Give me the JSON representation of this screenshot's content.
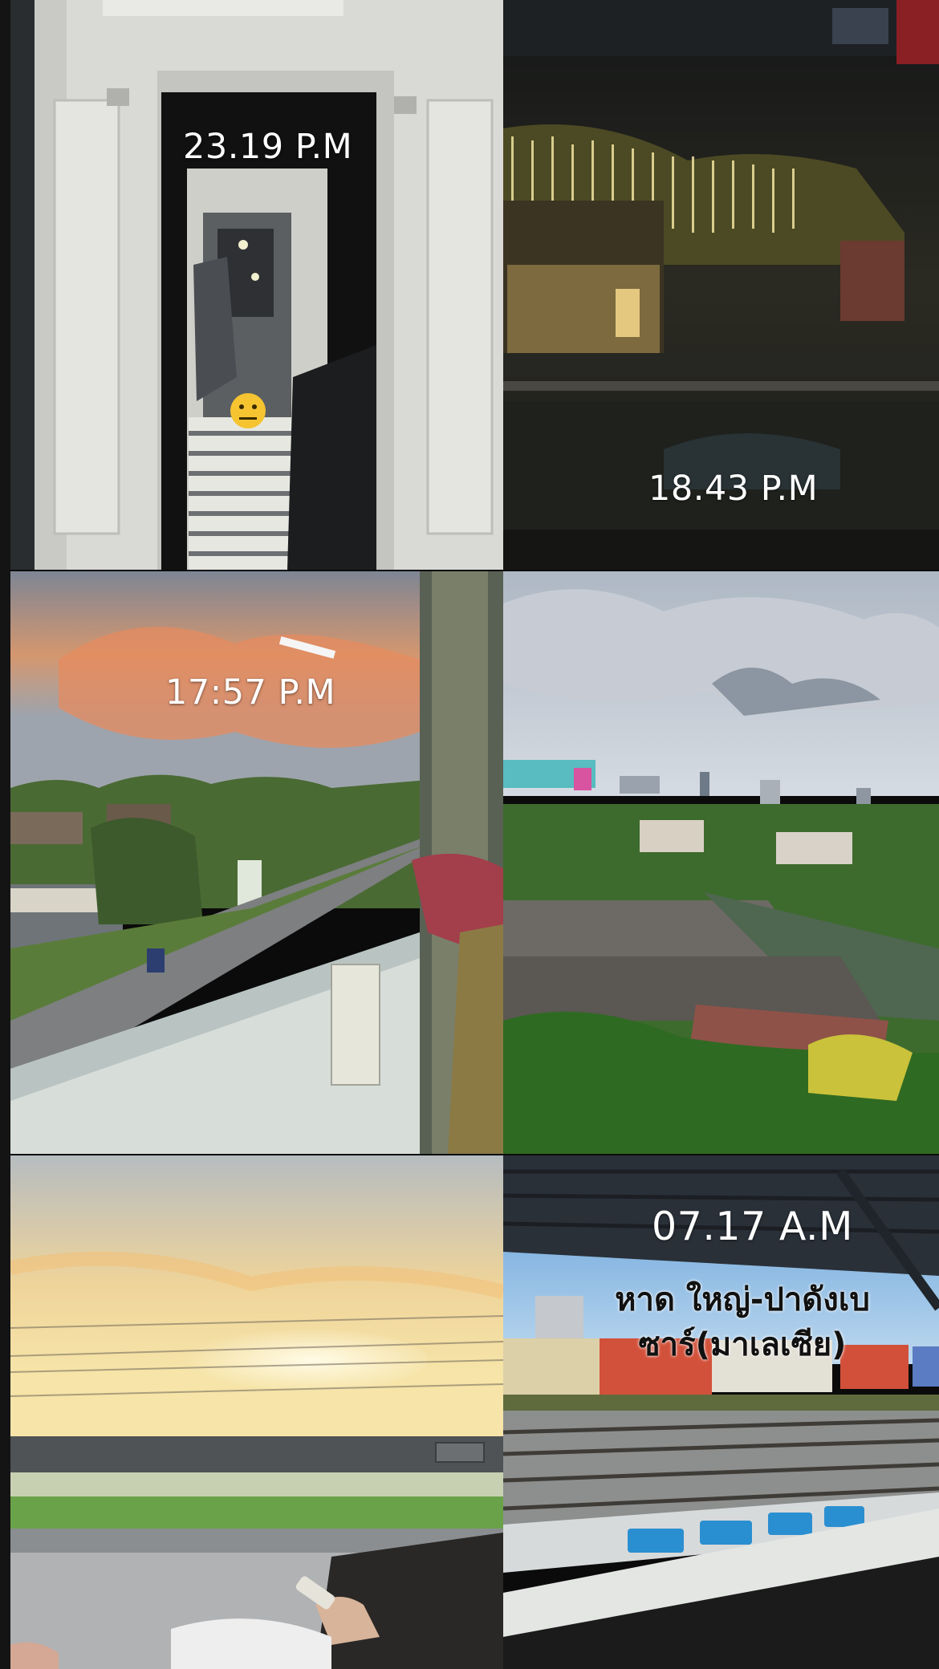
{
  "collage": {
    "tiles": [
      {
        "scene": "train-corridor-door",
        "timestamp": "23.19 P.M"
      },
      {
        "scene": "night-station-lights",
        "timestamp": "18.43 P.M"
      },
      {
        "scene": "sunset-window-road",
        "timestamp": "17:57 P.M"
      },
      {
        "scene": "city-canal-view",
        "timestamp": ""
      },
      {
        "scene": "sunrise-fields-window",
        "timestamp": ""
      },
      {
        "scene": "station-platform-containers",
        "timestamp": "07.17 A.M",
        "caption_line1": "หาด ใหญ่-ปาดังเบ",
        "caption_line2": "ซาร์(มาเลเซีย)"
      }
    ],
    "icons": [
      "neutral-face-emoji-icon"
    ],
    "colors": {
      "frame": "#0b0b0b",
      "stamp_text": "#ffffff",
      "caption_text": "#111111"
    }
  }
}
